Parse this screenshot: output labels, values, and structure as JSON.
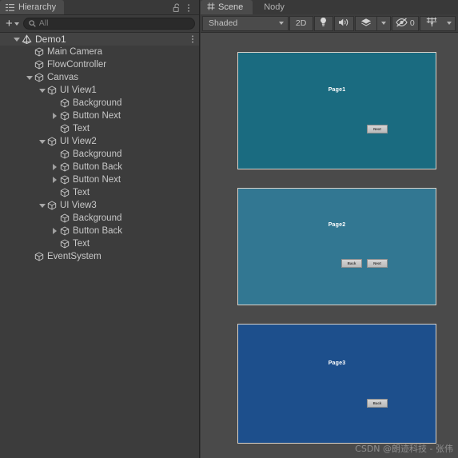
{
  "hierarchy": {
    "tab": {
      "label": "Hierarchy",
      "icon": "hierarchy-icon"
    },
    "lock_icon": "lock-open-icon",
    "menu_icon": "kebab-menu-icon",
    "toolbar": {
      "add_label": "+",
      "add_dropdown_icon": "chevron-down-icon",
      "search_icon": "search-icon",
      "search_value": "",
      "search_placeholder": "All"
    },
    "tree": [
      {
        "label": "Demo1",
        "depth": 0,
        "toggle": "open",
        "icon": "unity-scene-icon",
        "scene": true,
        "kebab": true
      },
      {
        "label": "Main Camera",
        "depth": 1,
        "toggle": "none",
        "icon": "gameobject-icon",
        "scene": false,
        "kebab": false
      },
      {
        "label": "FlowController",
        "depth": 1,
        "toggle": "none",
        "icon": "gameobject-icon",
        "scene": false,
        "kebab": false
      },
      {
        "label": "Canvas",
        "depth": 1,
        "toggle": "open",
        "icon": "gameobject-icon",
        "scene": false,
        "kebab": false
      },
      {
        "label": "UI View1",
        "depth": 2,
        "toggle": "open",
        "icon": "gameobject-icon",
        "scene": false,
        "kebab": false
      },
      {
        "label": "Background",
        "depth": 3,
        "toggle": "none",
        "icon": "gameobject-icon",
        "scene": false,
        "kebab": false
      },
      {
        "label": "Button Next",
        "depth": 3,
        "toggle": "closed",
        "icon": "gameobject-icon",
        "scene": false,
        "kebab": false
      },
      {
        "label": "Text",
        "depth": 3,
        "toggle": "none",
        "icon": "gameobject-icon",
        "scene": false,
        "kebab": false
      },
      {
        "label": "UI View2",
        "depth": 2,
        "toggle": "open",
        "icon": "gameobject-icon",
        "scene": false,
        "kebab": false
      },
      {
        "label": "Background",
        "depth": 3,
        "toggle": "none",
        "icon": "gameobject-icon",
        "scene": false,
        "kebab": false
      },
      {
        "label": "Button Back",
        "depth": 3,
        "toggle": "closed",
        "icon": "gameobject-icon",
        "scene": false,
        "kebab": false
      },
      {
        "label": "Button Next",
        "depth": 3,
        "toggle": "closed",
        "icon": "gameobject-icon",
        "scene": false,
        "kebab": false
      },
      {
        "label": "Text",
        "depth": 3,
        "toggle": "none",
        "icon": "gameobject-icon",
        "scene": false,
        "kebab": false
      },
      {
        "label": "UI View3",
        "depth": 2,
        "toggle": "open",
        "icon": "gameobject-icon",
        "scene": false,
        "kebab": false
      },
      {
        "label": "Background",
        "depth": 3,
        "toggle": "none",
        "icon": "gameobject-icon",
        "scene": false,
        "kebab": false
      },
      {
        "label": "Button Back",
        "depth": 3,
        "toggle": "closed",
        "icon": "gameobject-icon",
        "scene": false,
        "kebab": false
      },
      {
        "label": "Text",
        "depth": 3,
        "toggle": "none",
        "icon": "gameobject-icon",
        "scene": false,
        "kebab": false
      },
      {
        "label": "EventSystem",
        "depth": 1,
        "toggle": "none",
        "icon": "gameobject-icon",
        "scene": false,
        "kebab": false
      }
    ]
  },
  "scene": {
    "tabs": [
      {
        "label": "Scene",
        "icon": "scene-grid-icon",
        "active": true
      },
      {
        "label": "Nody",
        "icon": "",
        "active": false
      }
    ],
    "toolbar": {
      "draw_mode": "Shaded",
      "draw_mode_caret": "chevron-down-icon",
      "view_mode_2d": "2D",
      "lighting_icon": "lightbulb-icon",
      "audio_icon": "speaker-icon",
      "fx_icon": "effects-icon",
      "fx_caret": "chevron-down-icon",
      "visibility_icon": "eye-off-icon",
      "visibility_count": "0",
      "gizmos_icon": "gizmos-icon",
      "gizmos_caret": "chevron-down-icon"
    },
    "views": [
      {
        "name": "UI View1",
        "title": "Page1",
        "bg_color": "#1a6b80",
        "buttons": [
          {
            "label": "Next",
            "name": "button-next"
          }
        ]
      },
      {
        "name": "UI View2",
        "title": "Page2",
        "bg_color": "#327792",
        "buttons": [
          {
            "label": "Back",
            "name": "button-back"
          },
          {
            "label": "Next",
            "name": "button-next"
          }
        ]
      },
      {
        "name": "UI View3",
        "title": "Page3",
        "bg_color": "#1d4f8c",
        "buttons": [
          {
            "label": "Back",
            "name": "button-back"
          }
        ]
      }
    ],
    "watermark": "CSDN @朗迹科技 - 张伟"
  },
  "colors": {
    "panel_bg": "#3c3c3c",
    "scene_bg": "#4a4a4a",
    "tab_active": "#4b4b4b",
    "selected_row": "#434343",
    "text": "#c8c8c8"
  }
}
